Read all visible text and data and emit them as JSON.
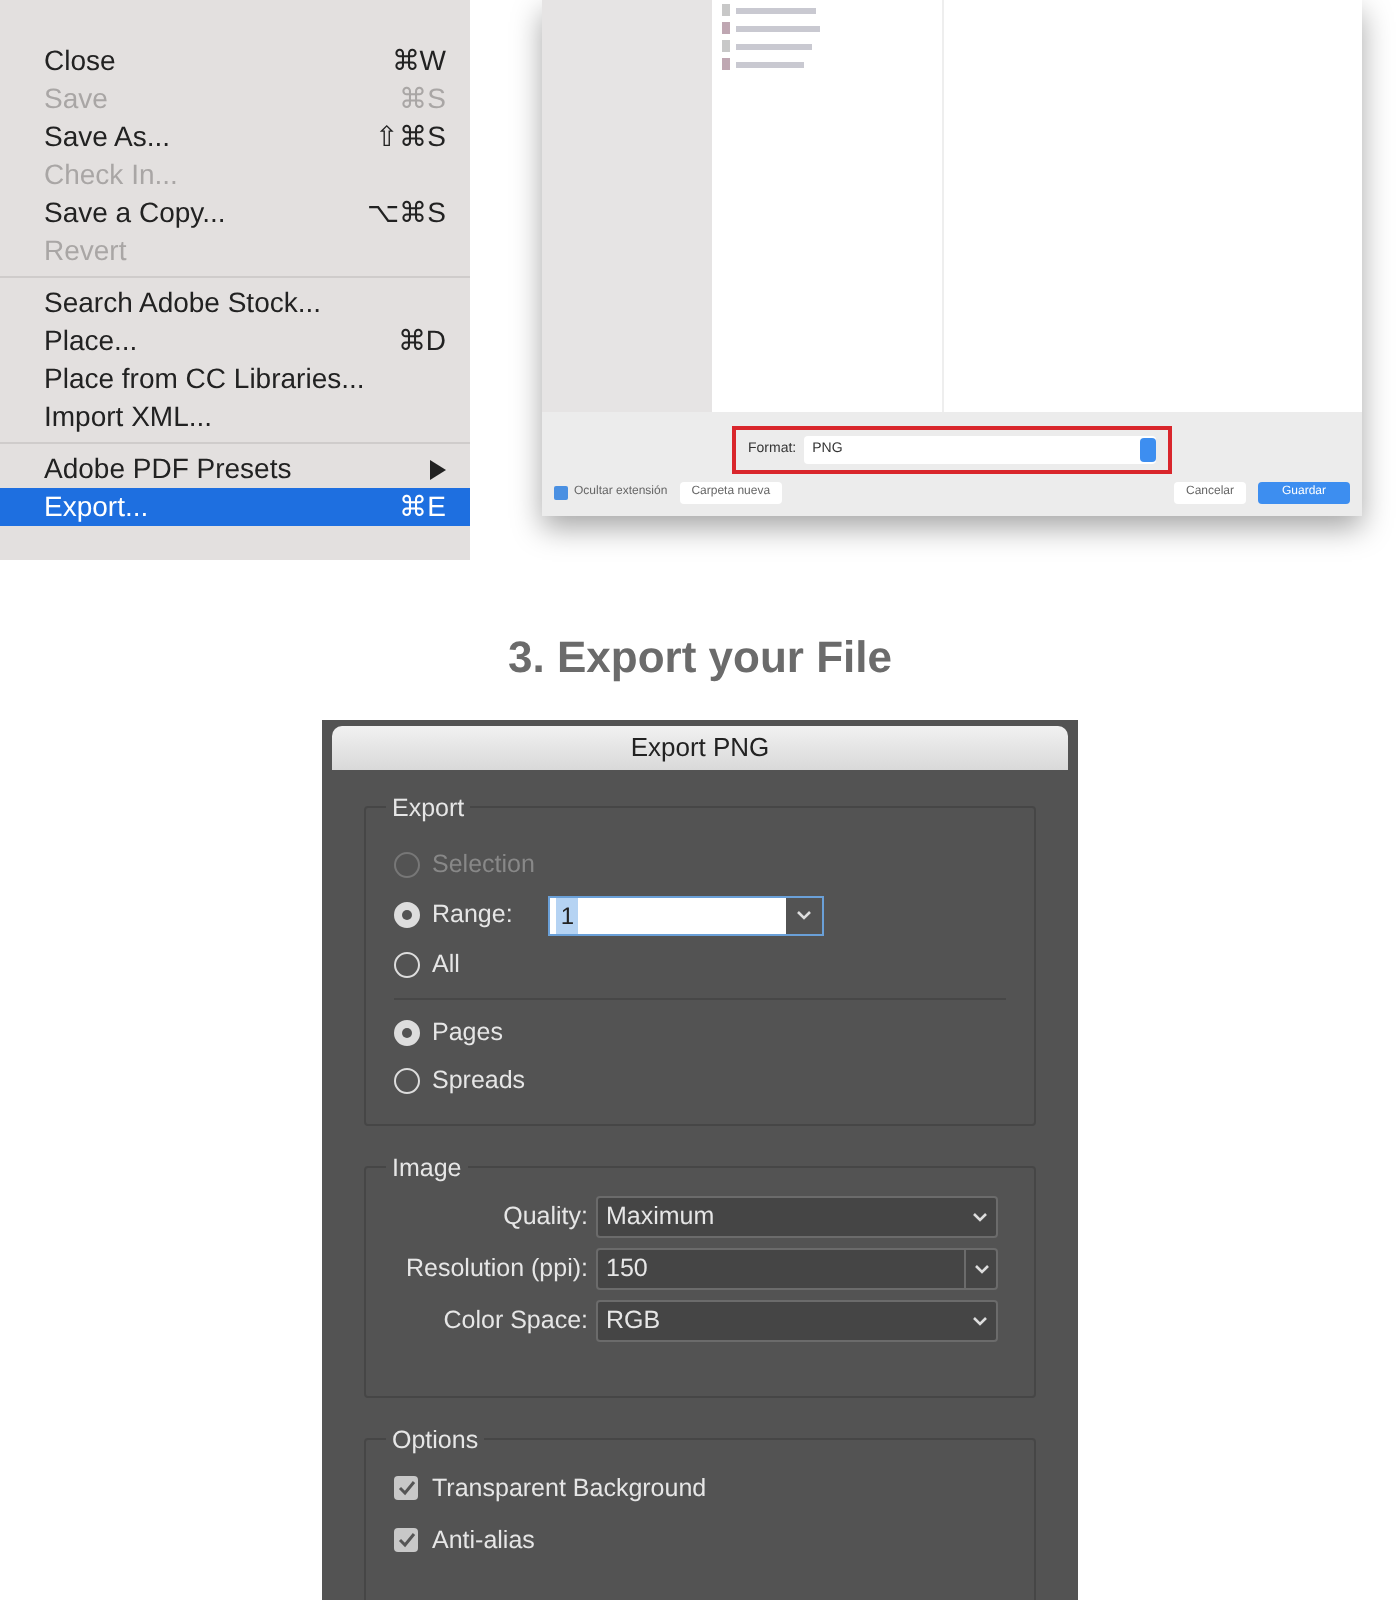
{
  "file_menu": {
    "groups": [
      {
        "items": [
          {
            "label": "Close",
            "shortcut": "⌘W",
            "disabled": false,
            "selected": false
          },
          {
            "label": "Save",
            "shortcut": "⌘S",
            "disabled": true,
            "selected": false
          },
          {
            "label": "Save As...",
            "shortcut": "⇧⌘S",
            "disabled": false,
            "selected": false
          },
          {
            "label": "Check In...",
            "disabled": true,
            "selected": false
          },
          {
            "label": "Save a Copy...",
            "shortcut": "⌥⌘S",
            "disabled": false,
            "selected": false
          },
          {
            "label": "Revert",
            "disabled": true,
            "selected": false
          }
        ]
      },
      {
        "items": [
          {
            "label": "Search Adobe Stock...",
            "disabled": false,
            "selected": false
          },
          {
            "label": "Place...",
            "shortcut": "⌘D",
            "disabled": false,
            "selected": false
          },
          {
            "label": "Place from CC Libraries...",
            "disabled": false,
            "selected": false
          },
          {
            "label": "Import XML...",
            "disabled": false,
            "selected": false
          }
        ]
      },
      {
        "items": [
          {
            "label": "Adobe PDF Presets",
            "submenu": true,
            "disabled": false,
            "selected": false
          },
          {
            "label": "Export...",
            "shortcut": "⌘E",
            "disabled": false,
            "selected": true
          }
        ]
      }
    ]
  },
  "save_dialog": {
    "format_label": "Format:",
    "format_value": "PNG",
    "hide_extension": {
      "label": "Ocultar extensión",
      "checked": true
    },
    "buttons": [
      {
        "label": "Carpeta nueva",
        "kind": "plain"
      },
      {
        "label": "Cancelar",
        "kind": "plain"
      },
      {
        "label": "Guardar",
        "kind": "primary"
      }
    ]
  },
  "step_heading": "3. Export your File",
  "export_dialog": {
    "title": "Export PNG",
    "export_group": {
      "title": "Export",
      "options": [
        {
          "label": "Selection",
          "selected": false,
          "disabled": true
        },
        {
          "label": "Range:",
          "selected": true,
          "disabled": false,
          "value": "1"
        },
        {
          "label": "All",
          "selected": false,
          "disabled": false
        }
      ],
      "layout_options": [
        {
          "label": "Pages",
          "selected": true
        },
        {
          "label": "Spreads",
          "selected": false
        }
      ]
    },
    "image_group": {
      "title": "Image",
      "fields": [
        {
          "label": "Quality:",
          "value": "Maximum",
          "kind": "select"
        },
        {
          "label": "Resolution (ppi):",
          "value": "150",
          "kind": "combo"
        },
        {
          "label": "Color Space:",
          "value": "RGB",
          "kind": "select"
        }
      ]
    },
    "options_group": {
      "title": "Options",
      "checks": [
        {
          "label": "Transparent Background",
          "checked": true
        },
        {
          "label": "Anti-alias",
          "checked": true
        }
      ]
    }
  }
}
